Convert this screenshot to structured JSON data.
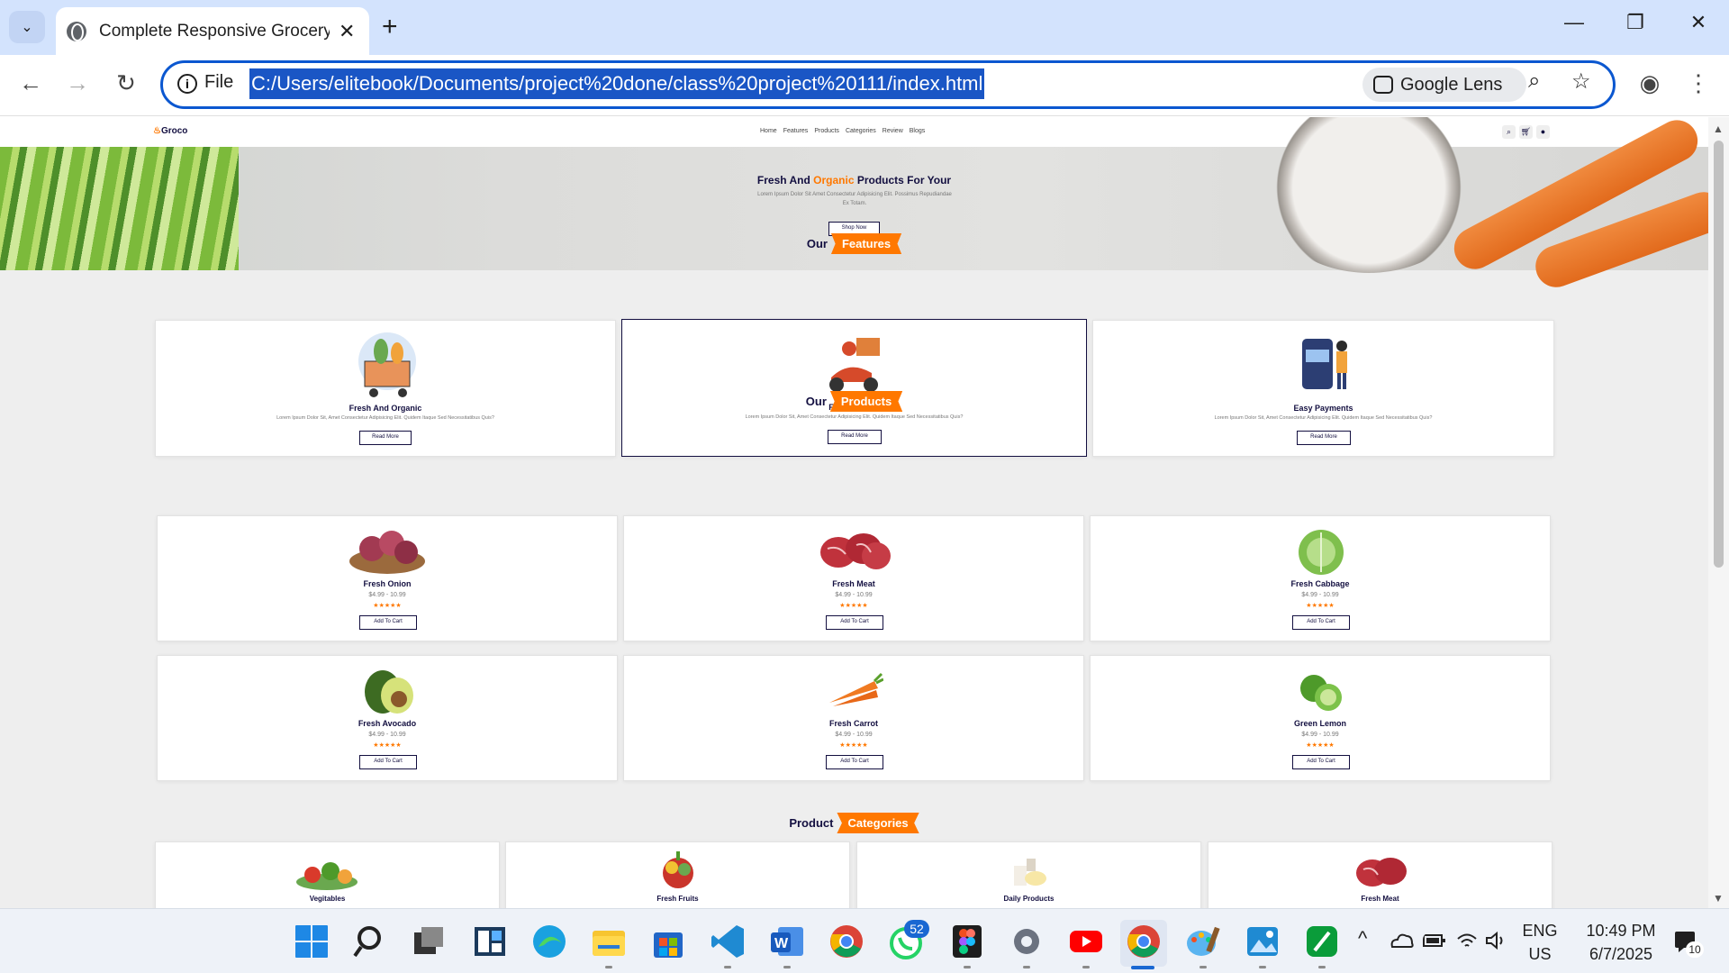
{
  "browser": {
    "tab_title": "Complete Responsive Grocery W",
    "file_label": "File",
    "url": "C:/Users/elitebook/Documents/project%20done/class%20project%20111/index.html",
    "lens_label": "Google Lens"
  },
  "site": {
    "logo_text": "Groco",
    "nav": [
      "Home",
      "Features",
      "Products",
      "Categories",
      "Review",
      "Blogs"
    ]
  },
  "hero": {
    "title_pre": "Fresh And ",
    "title_accent": "Organic",
    "title_post": " Products For Your",
    "text": "Lorem Ipsum Dolor Sit Amet Consectetur Adipisicing Elit. Possimus Repudiandae Ex Totam.",
    "button": "Shop Now"
  },
  "features": {
    "heading_pre": "Our",
    "heading_accent": "Features",
    "items": [
      {
        "title": "Fresh And Organic",
        "text": "Lorem Ipsum Dolor Sit, Amet Consectetur Adipisicing Elit. Quidem Itaque Sed Necessitatibus Quis?",
        "button": "Read More"
      },
      {
        "title": "Free Delivery",
        "text": "Lorem Ipsum Dolor Sit, Amet Consectetur Adipisicing Elit. Quidem Itaque Sed Necessitatibus Quis?",
        "button": "Read More"
      },
      {
        "title": "Easy Payments",
        "text": "Lorem Ipsum Dolor Sit, Amet Consectetur Adipisicing Elit. Quidem Itaque Sed Necessitatibus Quis?",
        "button": "Read More"
      }
    ]
  },
  "products": {
    "heading_pre": "Our",
    "heading_accent": "Products",
    "items": [
      {
        "name": "Fresh Onion",
        "price": "$4.99 - 10.99",
        "stars": "★★★★★",
        "button": "Add To Cart"
      },
      {
        "name": "Fresh Meat",
        "price": "$4.99 - 10.99",
        "stars": "★★★★★",
        "button": "Add To Cart"
      },
      {
        "name": "Fresh Cabbage",
        "price": "$4.99 - 10.99",
        "stars": "★★★★★",
        "button": "Add To Cart"
      },
      {
        "name": "Fresh Avocado",
        "price": "$4.99 - 10.99",
        "stars": "★★★★★",
        "button": "Add To Cart"
      },
      {
        "name": "Fresh Carrot",
        "price": "$4.99 - 10.99",
        "stars": "★★★★★",
        "button": "Add To Cart"
      },
      {
        "name": "Green Lemon",
        "price": "$4.99 - 10.99",
        "stars": "★★★★★",
        "button": "Add To Cart"
      }
    ]
  },
  "categories": {
    "heading_pre": "Product",
    "heading_accent": "Categories",
    "items": [
      "Vegitables",
      "Fresh Fruits",
      "Daily Products",
      "Fresh Meat"
    ]
  },
  "taskbar": {
    "whatsapp_badge": "52",
    "lang": "ENG",
    "region": "US",
    "time": "10:49 PM",
    "date": "6/7/2025",
    "notification_count": "10"
  },
  "colors": {
    "accent": "#ff7800",
    "dark": "#130f40",
    "url_highlight": "#1a56c5",
    "omnibox_border": "#0b57d0"
  }
}
